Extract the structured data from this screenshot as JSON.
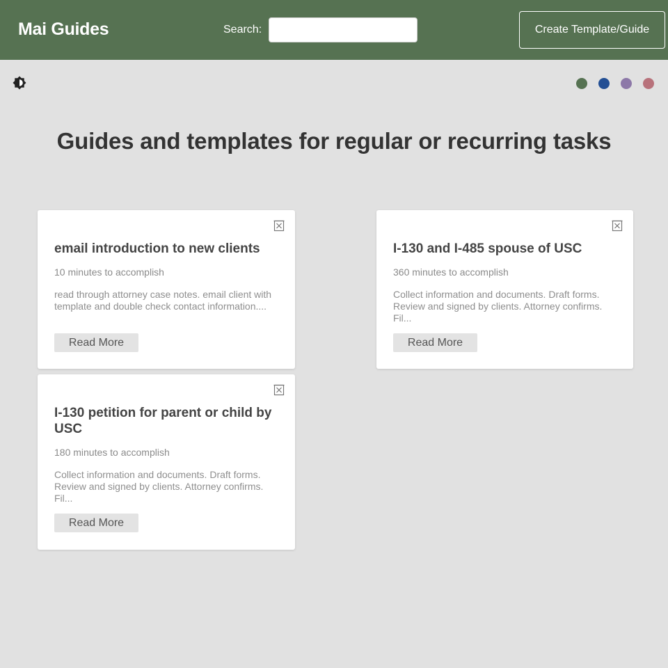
{
  "header": {
    "brand": "Mai Guides",
    "search_label": "Search:",
    "search_value": "",
    "create_button": "Create Template/Guide"
  },
  "toolbar": {
    "theme_toggle_icon": "brightness-contrast-icon",
    "swatches": [
      {
        "name": "green",
        "color": "#567252"
      },
      {
        "name": "blue",
        "color": "#234f94"
      },
      {
        "name": "purple",
        "color": "#8d78a8"
      },
      {
        "name": "rose",
        "color": "#b8727b"
      }
    ]
  },
  "main": {
    "title": "Guides and templates for regular or recurring tasks"
  },
  "cards": [
    {
      "title": "email introduction to new clients",
      "time": "10 minutes to accomplish",
      "description": "read through attorney case notes. email client with template and double check contact information....",
      "button": "Read More",
      "delete_icon": "delete-box-icon"
    },
    {
      "title": "I-130 and I-485 spouse of USC",
      "time": "360 minutes to accomplish",
      "description": "Collect information and documents. Draft forms. Review and signed by clients. Attorney confirms. Fil...",
      "button": "Read More",
      "delete_icon": "delete-box-icon"
    },
    {
      "title": "I-130 petition for parent or child by USC",
      "time": "180 minutes to accomplish",
      "description": "Collect information and documents. Draft forms. Review and signed by clients. Attorney confirms. Fil...",
      "button": "Read More",
      "delete_icon": "delete-box-icon"
    }
  ]
}
